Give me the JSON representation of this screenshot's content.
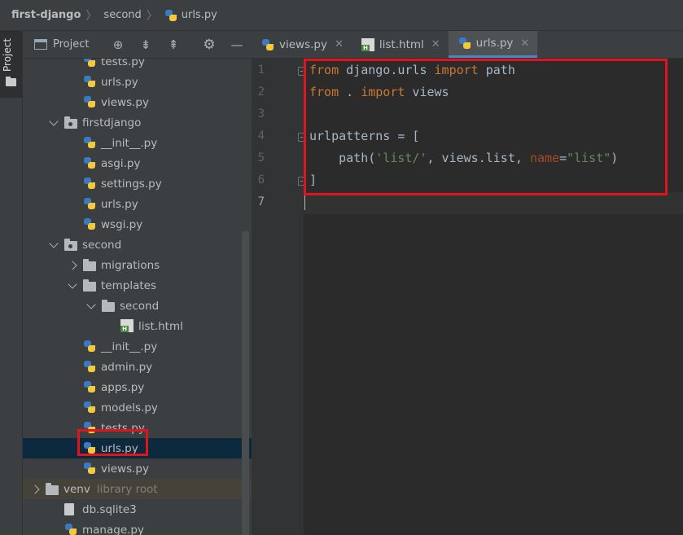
{
  "breadcrumb": {
    "items": [
      {
        "label": "first-django",
        "icon": "none"
      },
      {
        "label": "second",
        "icon": "none"
      },
      {
        "label": "urls.py",
        "icon": "python-file-icon"
      }
    ]
  },
  "toolstrip": {
    "label": "Project"
  },
  "project_panel": {
    "title": "Project",
    "header_icons": [
      "locate-icon",
      "expand-all-icon",
      "collapse-all-icon",
      "gear-icon",
      "hide-icon"
    ]
  },
  "tree": [
    {
      "label": "tests.py",
      "kind": "py",
      "depth": 3
    },
    {
      "label": "urls.py",
      "kind": "py",
      "depth": 3
    },
    {
      "label": "views.py",
      "kind": "py",
      "depth": 3
    },
    {
      "label": "firstdjango",
      "kind": "pkg",
      "depth": 2,
      "expanded": true
    },
    {
      "label": "__init__.py",
      "kind": "py",
      "depth": 3
    },
    {
      "label": "asgi.py",
      "kind": "py",
      "depth": 3
    },
    {
      "label": "settings.py",
      "kind": "py",
      "depth": 3
    },
    {
      "label": "urls.py",
      "kind": "py",
      "depth": 3
    },
    {
      "label": "wsgi.py",
      "kind": "py",
      "depth": 3
    },
    {
      "label": "second",
      "kind": "pkg",
      "depth": 2,
      "expanded": true
    },
    {
      "label": "migrations",
      "kind": "folder",
      "depth": 3,
      "expanded": false
    },
    {
      "label": "templates",
      "kind": "folder",
      "depth": 3,
      "expanded": true
    },
    {
      "label": "second",
      "kind": "folder",
      "depth": 4,
      "expanded": true
    },
    {
      "label": "list.html",
      "kind": "html",
      "depth": 5
    },
    {
      "label": "__init__.py",
      "kind": "py",
      "depth": 3
    },
    {
      "label": "admin.py",
      "kind": "py",
      "depth": 3
    },
    {
      "label": "apps.py",
      "kind": "py",
      "depth": 3
    },
    {
      "label": "models.py",
      "kind": "py",
      "depth": 3
    },
    {
      "label": "tests.py",
      "kind": "py",
      "depth": 3
    },
    {
      "label": "urls.py",
      "kind": "py",
      "depth": 3,
      "selected": true
    },
    {
      "label": "views.py",
      "kind": "py",
      "depth": 3
    },
    {
      "label": "venv",
      "kind": "folder",
      "depth": 1,
      "expanded": false,
      "suffix": "library root",
      "venv": true
    },
    {
      "label": "db.sqlite3",
      "kind": "file",
      "depth": 2
    },
    {
      "label": "manage.py",
      "kind": "py",
      "depth": 2
    }
  ],
  "tabs": [
    {
      "label": "views.py",
      "icon": "python-file-icon",
      "active": false
    },
    {
      "label": "list.html",
      "icon": "html-file-icon",
      "active": false
    },
    {
      "label": "urls.py",
      "icon": "python-file-icon",
      "active": true
    }
  ],
  "editor": {
    "line_numbers": [
      "1",
      "2",
      "3",
      "4",
      "5",
      "6",
      "7"
    ],
    "lines": [
      [
        {
          "t": "from",
          "c": "kw"
        },
        {
          "t": " django.urls ",
          "c": ""
        },
        {
          "t": "import",
          "c": "kw"
        },
        {
          "t": " path",
          "c": ""
        }
      ],
      [
        {
          "t": "from",
          "c": "kw"
        },
        {
          "t": " . ",
          "c": ""
        },
        {
          "t": "import",
          "c": "kw"
        },
        {
          "t": " views",
          "c": ""
        }
      ],
      [],
      [
        {
          "t": "urlpatterns = [",
          "c": ""
        }
      ],
      [
        {
          "t": "    path(",
          "c": ""
        },
        {
          "t": "'list/'",
          "c": "str"
        },
        {
          "t": ", views.list, ",
          "c": ""
        },
        {
          "t": "name",
          "c": "named"
        },
        {
          "t": "=",
          "c": ""
        },
        {
          "t": "\"list\"",
          "c": "str"
        },
        {
          "t": ")",
          "c": ""
        }
      ],
      [
        {
          "t": "]",
          "c": ""
        }
      ],
      []
    ]
  },
  "colors": {
    "highlight": "#e0141e",
    "keyword": "#cc7832",
    "string": "#6a8759",
    "named_arg": "#aa4926",
    "text": "#a9b7c6"
  }
}
